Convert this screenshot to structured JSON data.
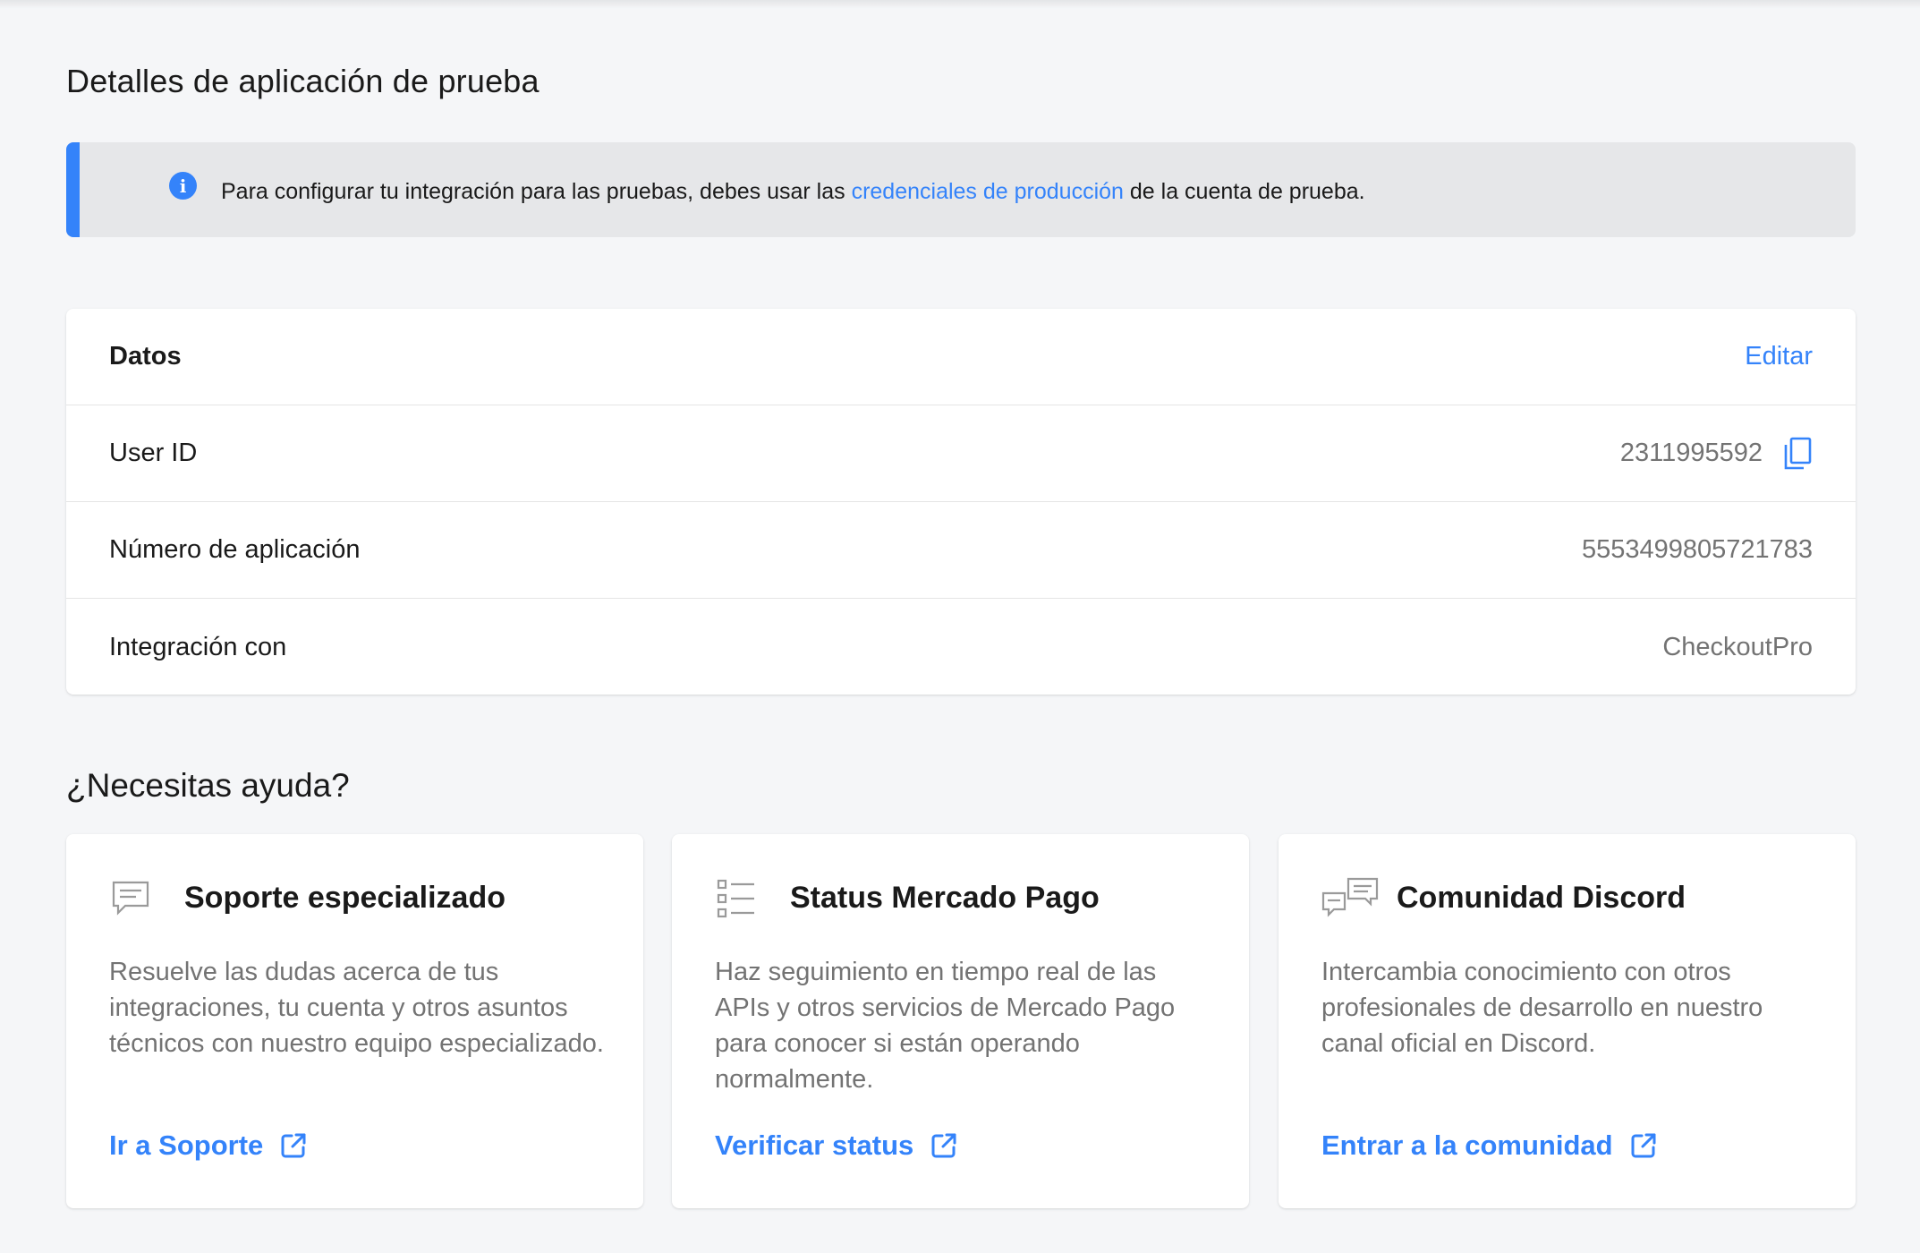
{
  "page": {
    "title": "Detalles de aplicación de prueba"
  },
  "notice": {
    "icon": "info-icon",
    "text_before": "Para configurar tu integración para las pruebas, debes usar las ",
    "link_text": "credenciales de producción",
    "text_after": " de la cuenta de prueba.",
    "accent_color": "#3483fa"
  },
  "data_card": {
    "header": "Datos",
    "edit_label": "Editar",
    "rows": [
      {
        "label": "User ID",
        "value": "2311995592",
        "copy_icon": "copy-icon"
      },
      {
        "label": "Número de aplicación",
        "value": "5553499805721783"
      },
      {
        "label": "Integración con",
        "value": "CheckoutPro"
      }
    ]
  },
  "help": {
    "title": "¿Necesitas ayuda?",
    "cards": [
      {
        "icon": "chat-bubble-icon",
        "title": "Soporte especializado",
        "description": "Resuelve las dudas acerca de tus integraciones, tu cuenta y otros asuntos técnicos con nuestro equipo especializado.",
        "link": "Ir a Soporte",
        "link_icon": "external-link-icon"
      },
      {
        "icon": "list-icon",
        "title": "Status Mercado Pago",
        "description": "Haz seguimiento en tiempo real de las APIs y otros servicios de Mercado Pago para conocer si están operando normalmente.",
        "link": "Verificar status",
        "link_icon": "external-link-icon"
      },
      {
        "icon": "community-chat-icon",
        "title": "Comunidad Discord",
        "description": "Intercambia conocimiento con otros profesionales de desarrollo en nuestro canal oficial en Discord.",
        "link": "Entrar a la comunidad",
        "link_icon": "external-link-icon"
      }
    ]
  },
  "colors": {
    "background": "#f5f6f8",
    "link": "#3483fa",
    "muted_text": "#737373"
  }
}
